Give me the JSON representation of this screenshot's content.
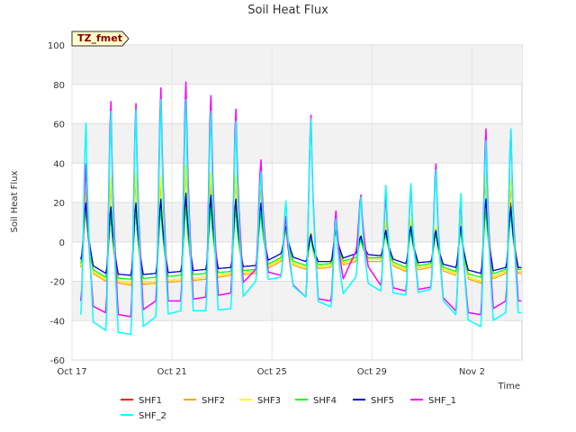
{
  "chart_data": {
    "type": "line",
    "title": "Soil Heat Flux",
    "xlabel": "Time",
    "ylabel": "Soil Heat Flux",
    "badge": "TZ_fmet",
    "xlim": [
      "2023-10-17",
      "2023-11-04"
    ],
    "ylim": [
      -60,
      100
    ],
    "yticks": [
      -60,
      -40,
      -20,
      0,
      20,
      40,
      60,
      80,
      100
    ],
    "xticks": [
      {
        "value": "2023-10-17",
        "label": "Oct 17"
      },
      {
        "value": "2023-10-21",
        "label": "Oct 21"
      },
      {
        "value": "2023-10-25",
        "label": "Oct 25"
      },
      {
        "value": "2023-10-29",
        "label": "Oct 29"
      },
      {
        "value": "2023-11-02",
        "label": "Nov 2"
      }
    ],
    "grid": true,
    "legend_position": "bottom",
    "days": [
      "Oct 17",
      "Oct 18",
      "Oct 19",
      "Oct 20",
      "Oct 21",
      "Oct 22",
      "Oct 23",
      "Oct 24",
      "Oct 25",
      "Oct 26",
      "Oct 27",
      "Oct 28",
      "Oct 29",
      "Oct 30",
      "Oct 31",
      "Nov 1",
      "Nov 2",
      "Nov 3"
    ],
    "series": [
      {
        "name": "SHF1",
        "color": "#ff0000",
        "daily_min": [
          -12,
          -19,
          -21,
          -20,
          -19,
          -18,
          -16,
          -15,
          -9,
          -13,
          -12,
          -9,
          -9,
          -14,
          -12,
          -16,
          -20,
          -15
        ],
        "daily_max": [
          18,
          14,
          18,
          20,
          22,
          22,
          21,
          20,
          8,
          3,
          6,
          2,
          5,
          8,
          6,
          8,
          22,
          20
        ]
      },
      {
        "name": "SHF2",
        "color": "#ffa500",
        "daily_min": [
          -13,
          -20,
          -22,
          -21,
          -20,
          -19,
          -17,
          -16,
          -10,
          -14,
          -13,
          -10,
          -10,
          -15,
          -13,
          -17,
          -21,
          -16
        ],
        "daily_max": [
          25,
          28,
          30,
          30,
          35,
          30,
          30,
          28,
          8,
          4,
          8,
          3,
          10,
          10,
          7,
          10,
          30,
          28
        ]
      },
      {
        "name": "SHF3",
        "color": "#ffff00",
        "daily_min": [
          -12,
          -19,
          -21,
          -20,
          -19,
          -18,
          -16,
          -15,
          -9,
          -13,
          -12,
          -9,
          -9,
          -14,
          -12,
          -16,
          -20,
          -15
        ],
        "daily_max": [
          26,
          33,
          35,
          34,
          40,
          36,
          34,
          32,
          10,
          5,
          9,
          4,
          11,
          12,
          8,
          12,
          34,
          32
        ]
      },
      {
        "name": "SHF4",
        "color": "#00ff00",
        "daily_min": [
          -11,
          -18,
          -19,
          -18,
          -17,
          -16,
          -15,
          -14,
          -8,
          -12,
          -11,
          -8,
          -8,
          -13,
          -11,
          -15,
          -18,
          -14
        ],
        "daily_max": [
          16,
          14,
          16,
          17,
          18,
          17,
          16,
          15,
          6,
          2,
          5,
          1,
          4,
          6,
          4,
          6,
          16,
          15
        ]
      },
      {
        "name": "SHF5",
        "color": "#0000cc",
        "daily_min": [
          -9,
          -16,
          -17,
          -16,
          -15,
          -14,
          -13,
          -12,
          -6,
          -10,
          -10,
          -6,
          -7,
          -11,
          -10,
          -13,
          -16,
          -13
        ],
        "daily_max": [
          20,
          18,
          20,
          22,
          25,
          24,
          22,
          20,
          8,
          4,
          6,
          3,
          6,
          8,
          6,
          8,
          22,
          18
        ]
      },
      {
        "name": "SHF_1",
        "color": "#ff00ff",
        "daily_min": [
          -30,
          -36,
          -38,
          -30,
          -30,
          -28,
          -26,
          -14,
          -17,
          -28,
          -30,
          -5,
          -22,
          -25,
          -23,
          -35,
          -37,
          -30
        ],
        "daily_max": [
          40,
          72,
          71,
          79,
          82,
          75,
          68,
          42,
          13,
          65,
          16,
          24,
          24,
          29,
          40,
          22,
          58,
          58
        ]
      },
      {
        "name": "SHF_2",
        "color": "#00ffff",
        "daily_min": [
          -37,
          -45,
          -47,
          -38,
          -35,
          -35,
          -34,
          -20,
          -18,
          -28,
          -33,
          -18,
          -25,
          -27,
          -24,
          -37,
          -43,
          -36
        ],
        "daily_max": [
          61,
          67,
          68,
          73,
          73,
          67,
          62,
          36,
          21,
          63,
          12,
          23,
          29,
          30,
          37,
          25,
          52,
          58
        ]
      }
    ]
  }
}
